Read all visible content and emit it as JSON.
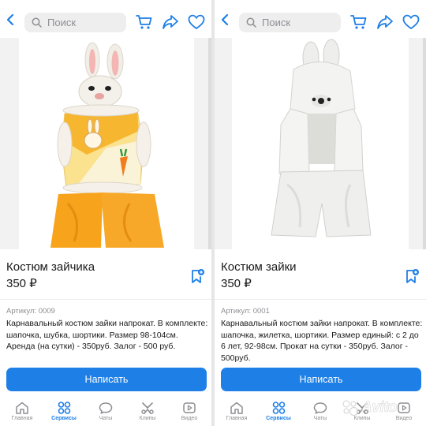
{
  "search": {
    "placeholder": "Поиск"
  },
  "panels": [
    {
      "title": "Костюм зайчика",
      "price": "350 ₽",
      "article": "Артикул: 0009",
      "description": "Карнавальный костюм зайки напрокат. В комплекте: шапочка, шубка, шортики. Размер 98-104см. Аренда (на сутки) - 350руб. Залог - 500 руб.",
      "button": "Написать"
    },
    {
      "title": "Костюм зайки",
      "price": "350 ₽",
      "article": "Артикул: 0001",
      "description": "Карнавальный костюм зайки напрокат. В комплекте: шапочка, жилетка, шортики. Размер единый: с 2 до 6 лет, 92-98см. Прокат на сутки - 350руб. Залог - 500руб.",
      "button": "Написать"
    }
  ],
  "tabbar": {
    "items": [
      {
        "label": "Главная",
        "icon": "home-icon",
        "active": false
      },
      {
        "label": "Сервисы",
        "icon": "services-icon",
        "active": true
      },
      {
        "label": "Чаты",
        "icon": "chat-icon",
        "active": false
      },
      {
        "label": "Клипы",
        "icon": "clips-icon",
        "active": false
      },
      {
        "label": "Видео",
        "icon": "video-icon",
        "active": false
      }
    ]
  },
  "watermark": {
    "text": "Avito"
  },
  "colors": {
    "accent": "#1e7fe6",
    "orange": "#f7a51c",
    "muted": "#8e8e93"
  }
}
